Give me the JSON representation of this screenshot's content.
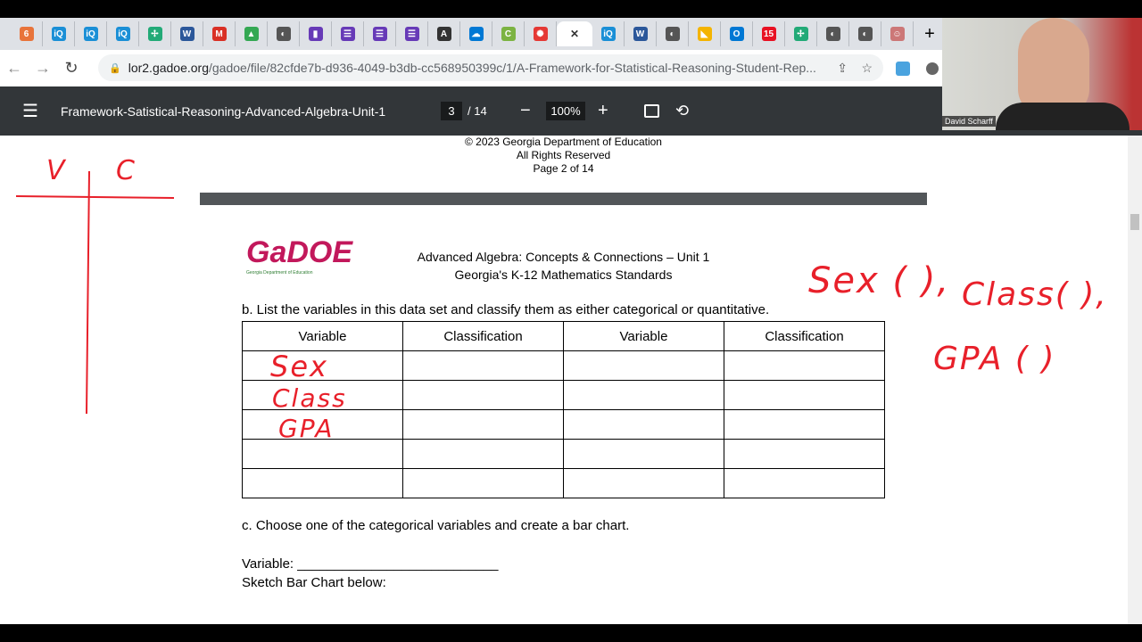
{
  "browser": {
    "tabs": [
      {
        "icon": "6",
        "color": "#e8743b"
      },
      {
        "icon": "iQ",
        "color": "#1a8fd6"
      },
      {
        "icon": "iQ",
        "color": "#1a8fd6"
      },
      {
        "icon": "iQ",
        "color": "#1a8fd6"
      },
      {
        "icon": "✢",
        "color": "#2a7"
      },
      {
        "icon": "W",
        "color": "#2b579a"
      },
      {
        "icon": "M",
        "color": "#d93025"
      },
      {
        "icon": "▲",
        "color": "#34a853"
      },
      {
        "icon": "◐",
        "color": "#555"
      },
      {
        "icon": "▮",
        "color": "#673ab7"
      },
      {
        "icon": "☰",
        "color": "#673ab7"
      },
      {
        "icon": "☰",
        "color": "#673ab7"
      },
      {
        "icon": "☰",
        "color": "#673ab7"
      },
      {
        "icon": "A",
        "color": "#333"
      },
      {
        "icon": "☁",
        "color": "#0078d4"
      },
      {
        "icon": "C",
        "color": "#7cb342"
      },
      {
        "icon": "✺",
        "color": "#e53935"
      }
    ],
    "active_tab_close": "✕",
    "tabs_after": [
      {
        "icon": "iQ",
        "color": "#1a8fd6"
      },
      {
        "icon": "W",
        "color": "#2b579a"
      },
      {
        "icon": "◐",
        "color": "#555"
      },
      {
        "icon": "◣",
        "color": "#f4b400"
      },
      {
        "icon": "O",
        "color": "#0078d4"
      },
      {
        "icon": "15",
        "color": "#e81123"
      },
      {
        "icon": "✢",
        "color": "#2a7"
      },
      {
        "icon": "◐",
        "color": "#555"
      },
      {
        "icon": "◐",
        "color": "#555"
      },
      {
        "icon": "☺",
        "color": "#c77"
      }
    ],
    "new_tab": "+",
    "url_host": "lor2.gadoe.org",
    "url_path": "/gadoe/file/82cfde7b-d936-4049-b3db-cc568950399c/1/A-Framework-for-Statistical-Reasoning-Student-Rep..."
  },
  "pdf": {
    "title": "Framework-Satistical-Reasoning-Advanced-Algebra-Unit-1",
    "page_current": "3",
    "page_total": "/ 14",
    "zoom": "100%"
  },
  "page1_footer": [
    "© 2023 Georgia Department of Education",
    "All Rights Reserved",
    "Page 2 of 14"
  ],
  "page2": {
    "logo": "GaDOE",
    "logo_sub": "Georgia Department of Education",
    "header1": "Advanced Algebra: Concepts & Connections – Unit 1",
    "header2": "Georgia's K-12 Mathematics Standards",
    "question_b": "b. List the variables in this data set and classify them as either categorical or quantitative.",
    "table_headers": [
      "Variable",
      "Classification",
      "Variable",
      "Classification"
    ],
    "question_c": "c. Choose one of the categorical variables and create a bar chart.",
    "variable_label": "Variable: ___________________________",
    "sketch_label": "Sketch Bar Chart below:"
  },
  "annotations": {
    "tchart": [
      "V",
      "C"
    ],
    "table_entries": [
      "Sex",
      "Class",
      "GPA"
    ],
    "right_notes": [
      "Sex (      ),",
      "Class(     ),",
      "GPA (   )"
    ],
    "color": "#e8202a"
  },
  "webcam": {
    "name": "David Scharff"
  }
}
